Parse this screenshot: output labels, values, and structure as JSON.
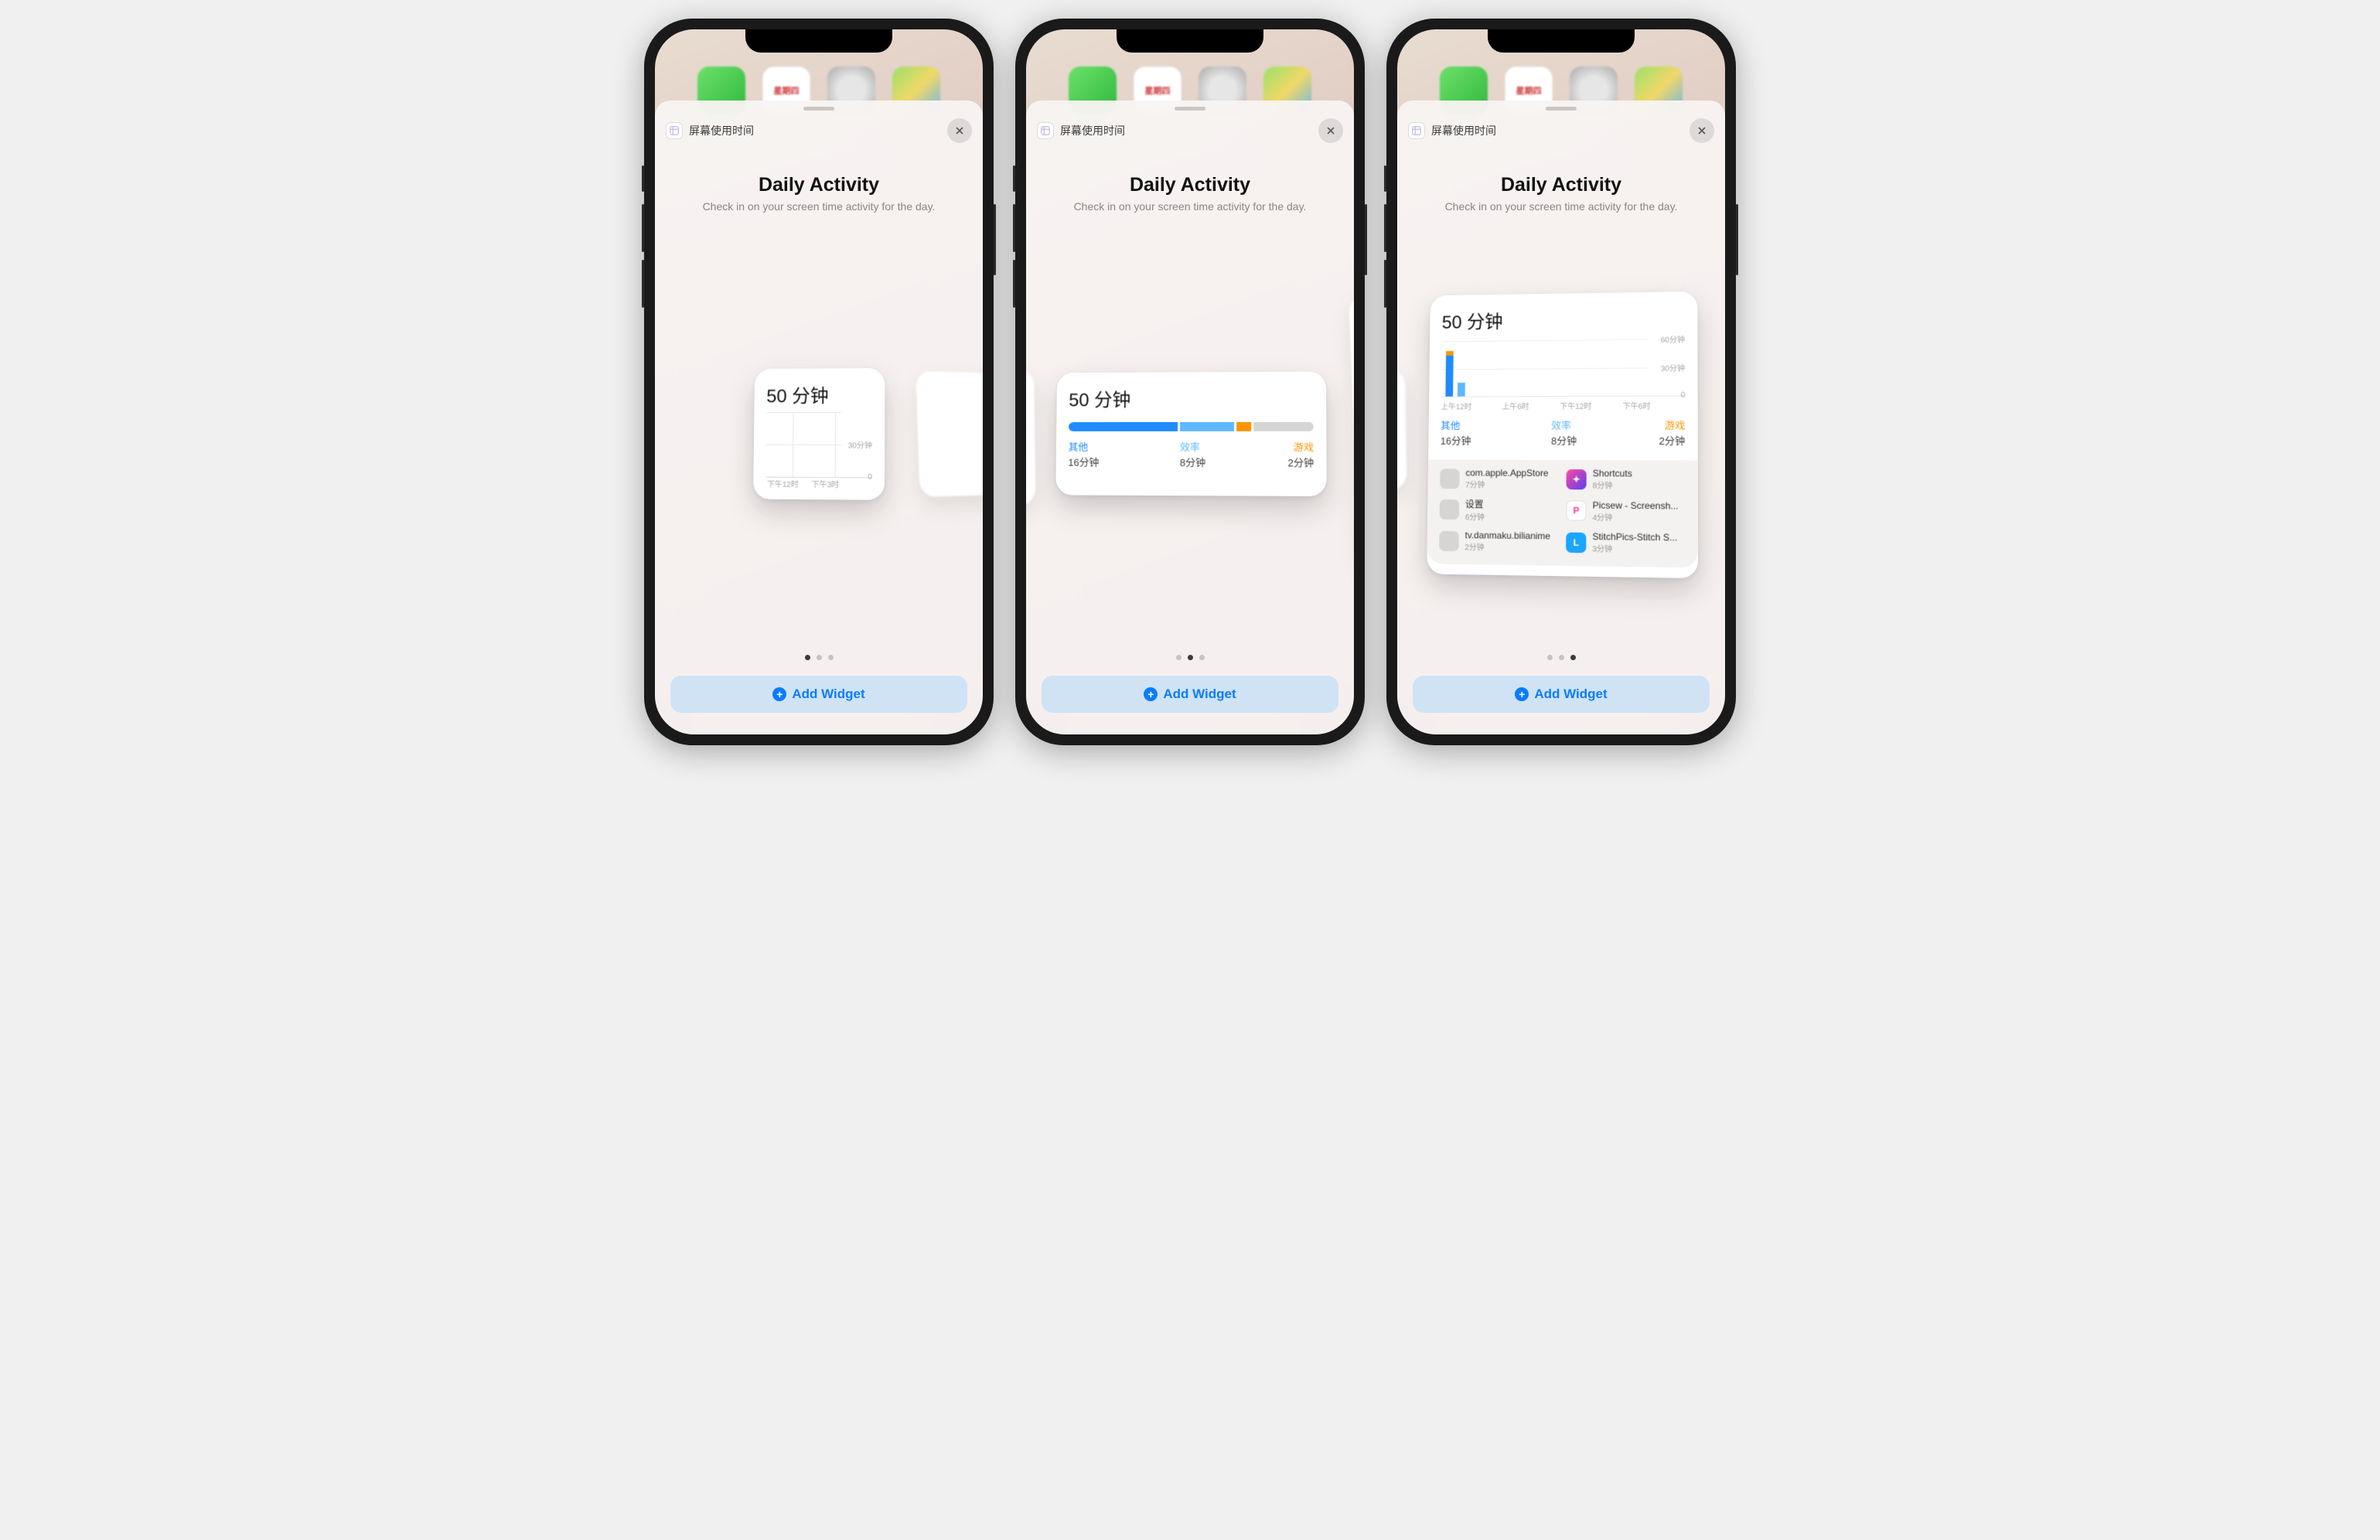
{
  "header_app_name": "屏幕使用时间",
  "calendar_day": "星期四",
  "title": "Daily Activity",
  "subtitle": "Check in on your screen time activity for the day.",
  "add_widget_label": "Add Widget",
  "total_time": "50 分钟",
  "categories": [
    {
      "name": "其他",
      "value": "16分钟",
      "color": "#1e8bff",
      "minutes": 16
    },
    {
      "name": "效率",
      "value": "8分钟",
      "color": "#5eb8ff",
      "minutes": 8
    },
    {
      "name": "游戏",
      "value": "2分钟",
      "color": "#ff9500",
      "minutes": 2
    }
  ],
  "small_widget": {
    "y_labels": [
      "30分钟",
      "0"
    ],
    "x_labels": [
      "下午12时",
      "下午3时"
    ]
  },
  "large_widget": {
    "y_labels": [
      "60分钟",
      "30分钟",
      "0"
    ],
    "x_labels": [
      "上午12时",
      "上午6时",
      "下午12时",
      "下午6时"
    ],
    "apps": [
      {
        "name": "com.apple.AppStore",
        "time": "7分钟",
        "color": "#d7d5d4",
        "icon": ""
      },
      {
        "name": "Shortcuts",
        "time": "8分钟",
        "color": "linear-gradient(135deg,#ff4aa2,#5a3ff0)",
        "icon": "✦"
      },
      {
        "name": "设置",
        "time": "6分钟",
        "color": "#d7d5d4",
        "icon": ""
      },
      {
        "name": "Picsew - Screensh...",
        "time": "4分钟",
        "color": "#fff",
        "icon": "P",
        "fg": "#ff3b8a"
      },
      {
        "name": "tv.danmaku.bilianime",
        "time": "2分钟",
        "color": "#d7d5d4",
        "icon": ""
      },
      {
        "name": "StitchPics-Stitch S...",
        "time": "3分钟",
        "color": "#1aa5ff",
        "icon": "L"
      }
    ]
  },
  "chart_data": {
    "type": "bar",
    "title": "Screen Time — Daily Activity",
    "x": [
      "上午12时",
      "上午6时",
      "下午12时",
      "下午6时"
    ],
    "xlabel": "",
    "ylabel": "分钟",
    "ylim": [
      0,
      60
    ],
    "series": [
      {
        "name": "其他",
        "color": "#1e8bff",
        "values": [
          44,
          0,
          0,
          0
        ]
      },
      {
        "name": "效率",
        "color": "#5eb8ff",
        "values": [
          14,
          0,
          0,
          0
        ]
      },
      {
        "name": "游戏",
        "color": "#ff9500",
        "values": [
          0,
          0,
          0,
          0
        ]
      }
    ],
    "category_totals": {
      "其他": 16,
      "效率": 8,
      "游戏": 2
    },
    "total_minutes": 50
  }
}
